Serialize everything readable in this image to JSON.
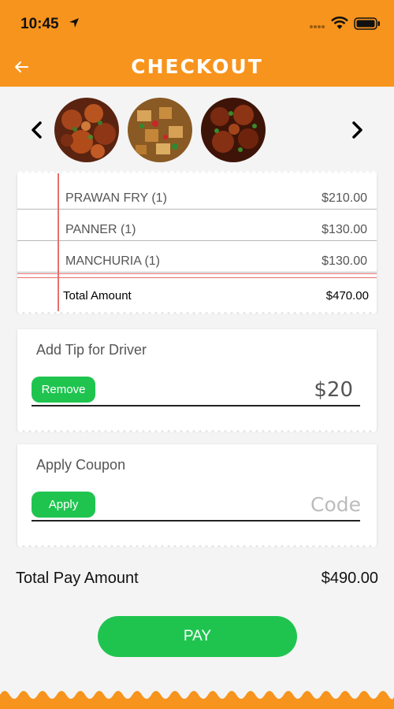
{
  "status": {
    "time": "10:45"
  },
  "header": {
    "title": "CHECKOUT",
    "back_icon": "arrow-left-icon"
  },
  "carousel": {
    "prev_icon": "chevron-left-icon",
    "next_icon": "chevron-right-icon",
    "images": [
      "Prawan Fry",
      "Panner",
      "Manchuria"
    ]
  },
  "order": {
    "items": [
      {
        "name": "PRAWAN FRY (1)",
        "price": "$210.00"
      },
      {
        "name": "PANNER (1)",
        "price": "$130.00"
      },
      {
        "name": "MANCHURIA (1)",
        "price": "$130.00"
      }
    ],
    "total_label": "Total Amount",
    "total_value": "$470.00"
  },
  "tip": {
    "title": "Add Tip for Driver",
    "button_label": "Remove",
    "value": "$20"
  },
  "coupon": {
    "title": "Apply Coupon",
    "button_label": "Apply",
    "placeholder": "Code",
    "value": ""
  },
  "summary": {
    "label": "Total Pay Amount",
    "value": "$490.00"
  },
  "pay_button": {
    "label": "PAY"
  },
  "colors": {
    "brand": "#f7941d",
    "accent": "#1fc44f",
    "margin_line": "#e76f6f"
  }
}
